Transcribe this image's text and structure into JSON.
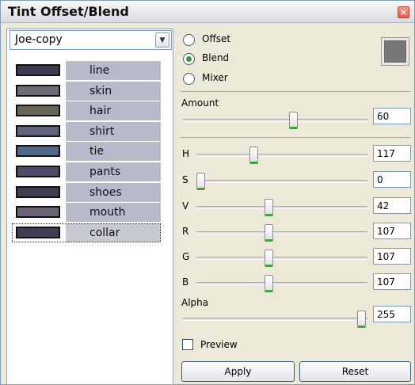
{
  "window": {
    "title": "Tint Offset/Blend",
    "close_label": "×"
  },
  "character_select": {
    "value": "Joe-copy"
  },
  "layers": [
    {
      "name": "line",
      "color": "#3b3c52"
    },
    {
      "name": "skin",
      "color": "#6d6c7a"
    },
    {
      "name": "hair",
      "color": "#6a6458"
    },
    {
      "name": "shirt",
      "color": "#5e6479"
    },
    {
      "name": "tie",
      "color": "#4d6987"
    },
    {
      "name": "pants",
      "color": "#4f4866"
    },
    {
      "name": "shoes",
      "color": "#3d3e52"
    },
    {
      "name": "mouth",
      "color": "#6e6479"
    },
    {
      "name": "collar",
      "color": "#3e3f52"
    }
  ],
  "mode": {
    "options": [
      "Offset",
      "Blend",
      "Mixer"
    ],
    "selected": "Blend"
  },
  "preview_color": "#777777",
  "amount": {
    "label": "Amount",
    "value": "60",
    "fraction": 0.6
  },
  "channels": [
    {
      "label": "H",
      "value": "117",
      "fraction": 0.33
    },
    {
      "label": "S",
      "value": "0",
      "fraction": 0.0
    },
    {
      "label": "V",
      "value": "42",
      "fraction": 0.42
    },
    {
      "label": "R",
      "value": "107",
      "fraction": 0.42
    },
    {
      "label": "G",
      "value": "107",
      "fraction": 0.42
    },
    {
      "label": "B",
      "value": "107",
      "fraction": 0.42
    }
  ],
  "alpha": {
    "label": "Alpha",
    "value": "255",
    "fraction": 1.0
  },
  "preview": {
    "label": "Preview",
    "checked": false
  },
  "buttons": {
    "apply": "Apply",
    "reset": "Reset"
  }
}
